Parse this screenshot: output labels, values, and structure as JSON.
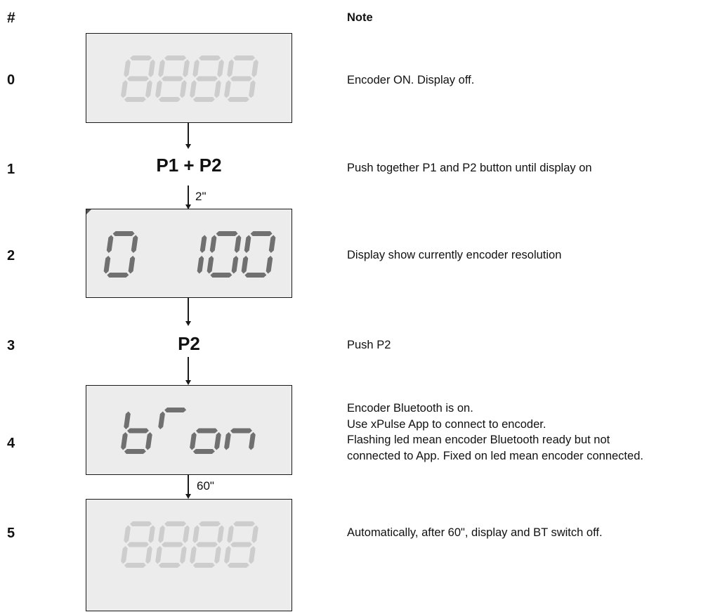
{
  "header": {
    "num_label": "#",
    "note_label": "Note"
  },
  "steps": [
    {
      "num": "0",
      "display": "8888",
      "note": "Encoder ON. Display off."
    },
    {
      "num": "1",
      "button": "P1 + P2",
      "note": "Push together P1 and P2 button until display on"
    },
    {
      "num": "2",
      "display": "0 100",
      "note": "Display show currently encoder resolution"
    },
    {
      "num": "3",
      "button": "P2",
      "note": "Push P2"
    },
    {
      "num": "4",
      "display": "bT on",
      "note_lines": [
        "Encoder Bluetooth is on.",
        "Use xPulse App to connect to encoder.",
        "Flashing led mean encoder Bluetooth ready but not",
        "connected to App. Fixed on led mean encoder connected."
      ]
    },
    {
      "num": "5",
      "display": "8888",
      "note": "Automatically, after 60\", display and BT switch off."
    }
  ],
  "arrow_labels": {
    "after_p1p2": "2\"",
    "after_bton": "60\""
  },
  "colors": {
    "panel_bg": "#ececec",
    "segment_on": "#707070",
    "segment_ghost": "#cdcdcd",
    "border": "#1a1a1a"
  }
}
